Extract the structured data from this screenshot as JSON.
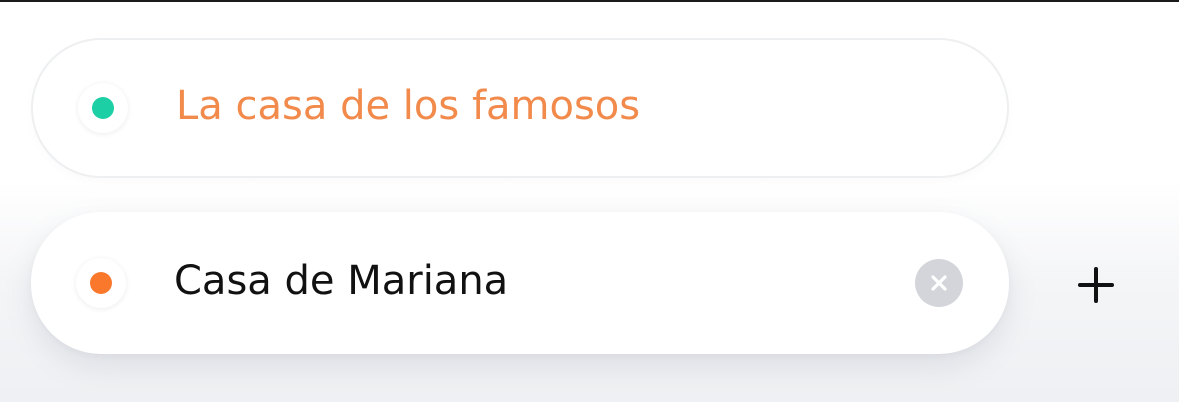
{
  "origin": {
    "label": "La casa de los famosos",
    "dot_color": "#1ccfa5",
    "text_color": "#f28a4b"
  },
  "destination": {
    "label": "Casa de Mariana",
    "dot_color": "#f9782c",
    "text_color": "#111111",
    "clear_icon": "close-icon"
  },
  "add_stop_icon": "plus-icon"
}
